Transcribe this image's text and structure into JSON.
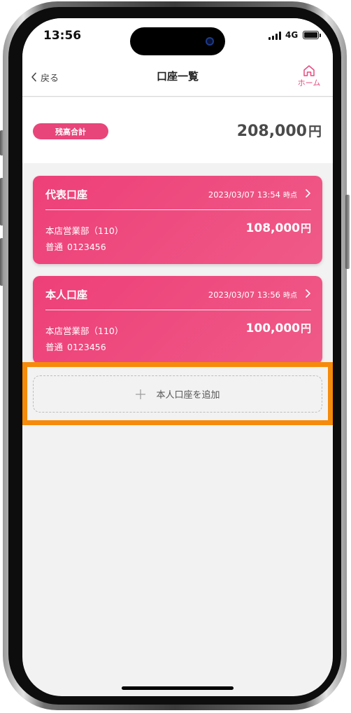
{
  "status_bar": {
    "time": "13:56",
    "network": "4G"
  },
  "nav": {
    "back_label": "戻る",
    "title": "口座一覧",
    "home_label": "ホーム"
  },
  "total": {
    "badge_label": "残高合計",
    "amount": "208,000",
    "currency": "円"
  },
  "accounts": [
    {
      "title": "代表口座",
      "timestamp": "2023/03/07 13:54",
      "timestamp_suffix": "時点",
      "branch": "本店営業部（110）",
      "account_type": "普通",
      "account_number": "0123456",
      "amount": "108,000",
      "currency": "円"
    },
    {
      "title": "本人口座",
      "timestamp": "2023/03/07 13:56",
      "timestamp_suffix": "時点",
      "branch": "本店営業部（110）",
      "account_type": "普通",
      "account_number": "0123456",
      "amount": "100,000",
      "currency": "円"
    }
  ],
  "add_account": {
    "label": "本人口座を追加"
  },
  "icons": {
    "back": "chevron-left-icon",
    "home": "home-icon",
    "card_chevron": "chevron-right-icon",
    "add": "plus-icon"
  },
  "colors": {
    "accent_pink": "#e8457a",
    "card_gradient_start": "#ee3f78",
    "card_gradient_end": "#ef5a88",
    "highlight_orange": "#f68a0a",
    "background": "#f2f2f2"
  }
}
